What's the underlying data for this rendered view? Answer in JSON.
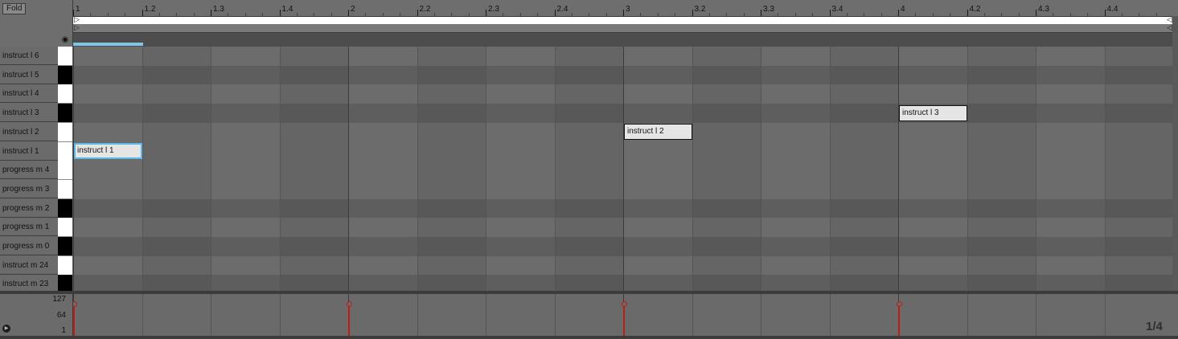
{
  "header": {
    "fold_label": "Fold",
    "headphone_icon": "headphone-icon"
  },
  "ruler": {
    "start": 1,
    "end": 4.5,
    "labels": [
      "1",
      "1.2",
      "1.3",
      "1.4",
      "2",
      "2.2",
      "2.3",
      "2.4",
      "3",
      "3.2",
      "3.3",
      "3.4",
      "4",
      "4.2",
      "4.3",
      "4.4"
    ]
  },
  "keys": [
    {
      "label": "instruct l 6",
      "color": "white"
    },
    {
      "label": "instruct l 5",
      "color": "black"
    },
    {
      "label": "instruct l 4",
      "color": "white"
    },
    {
      "label": "instruct l 3",
      "color": "black"
    },
    {
      "label": "instruct l 2",
      "color": "white"
    },
    {
      "label": "instruct l 1",
      "color": "white"
    },
    {
      "label": "progress m 4",
      "color": "white"
    },
    {
      "label": "progress m 3",
      "color": "white"
    },
    {
      "label": "progress m 2",
      "color": "black"
    },
    {
      "label": "progress m 1",
      "color": "white"
    },
    {
      "label": "progress m 0",
      "color": "black"
    },
    {
      "label": "instruct m 24",
      "color": "white"
    },
    {
      "label": "instruct m 23",
      "color": "black"
    }
  ],
  "notes": [
    {
      "label": "instruct l 1",
      "row": 5,
      "start": 1,
      "length": 0.25,
      "selected": true
    },
    {
      "label": "instruct l 2",
      "row": 4,
      "start": 3,
      "length": 0.25,
      "selected": false
    },
    {
      "label": "instruct l 3",
      "row": 3,
      "start": 4,
      "length": 0.25,
      "selected": false
    }
  ],
  "velocity": {
    "scale_max": "127",
    "scale_mid": "64",
    "scale_min": "1",
    "events": [
      {
        "time": 1,
        "velocity": 127
      },
      {
        "time": 2,
        "velocity": 127
      },
      {
        "time": 3,
        "velocity": 127
      },
      {
        "time": 4,
        "velocity": 127
      }
    ]
  },
  "grid": {
    "label": "1/4"
  },
  "colors": {
    "selection": "#5cb8e6",
    "velocity": "#c21c10",
    "note_fill": "#e5e5e5"
  }
}
